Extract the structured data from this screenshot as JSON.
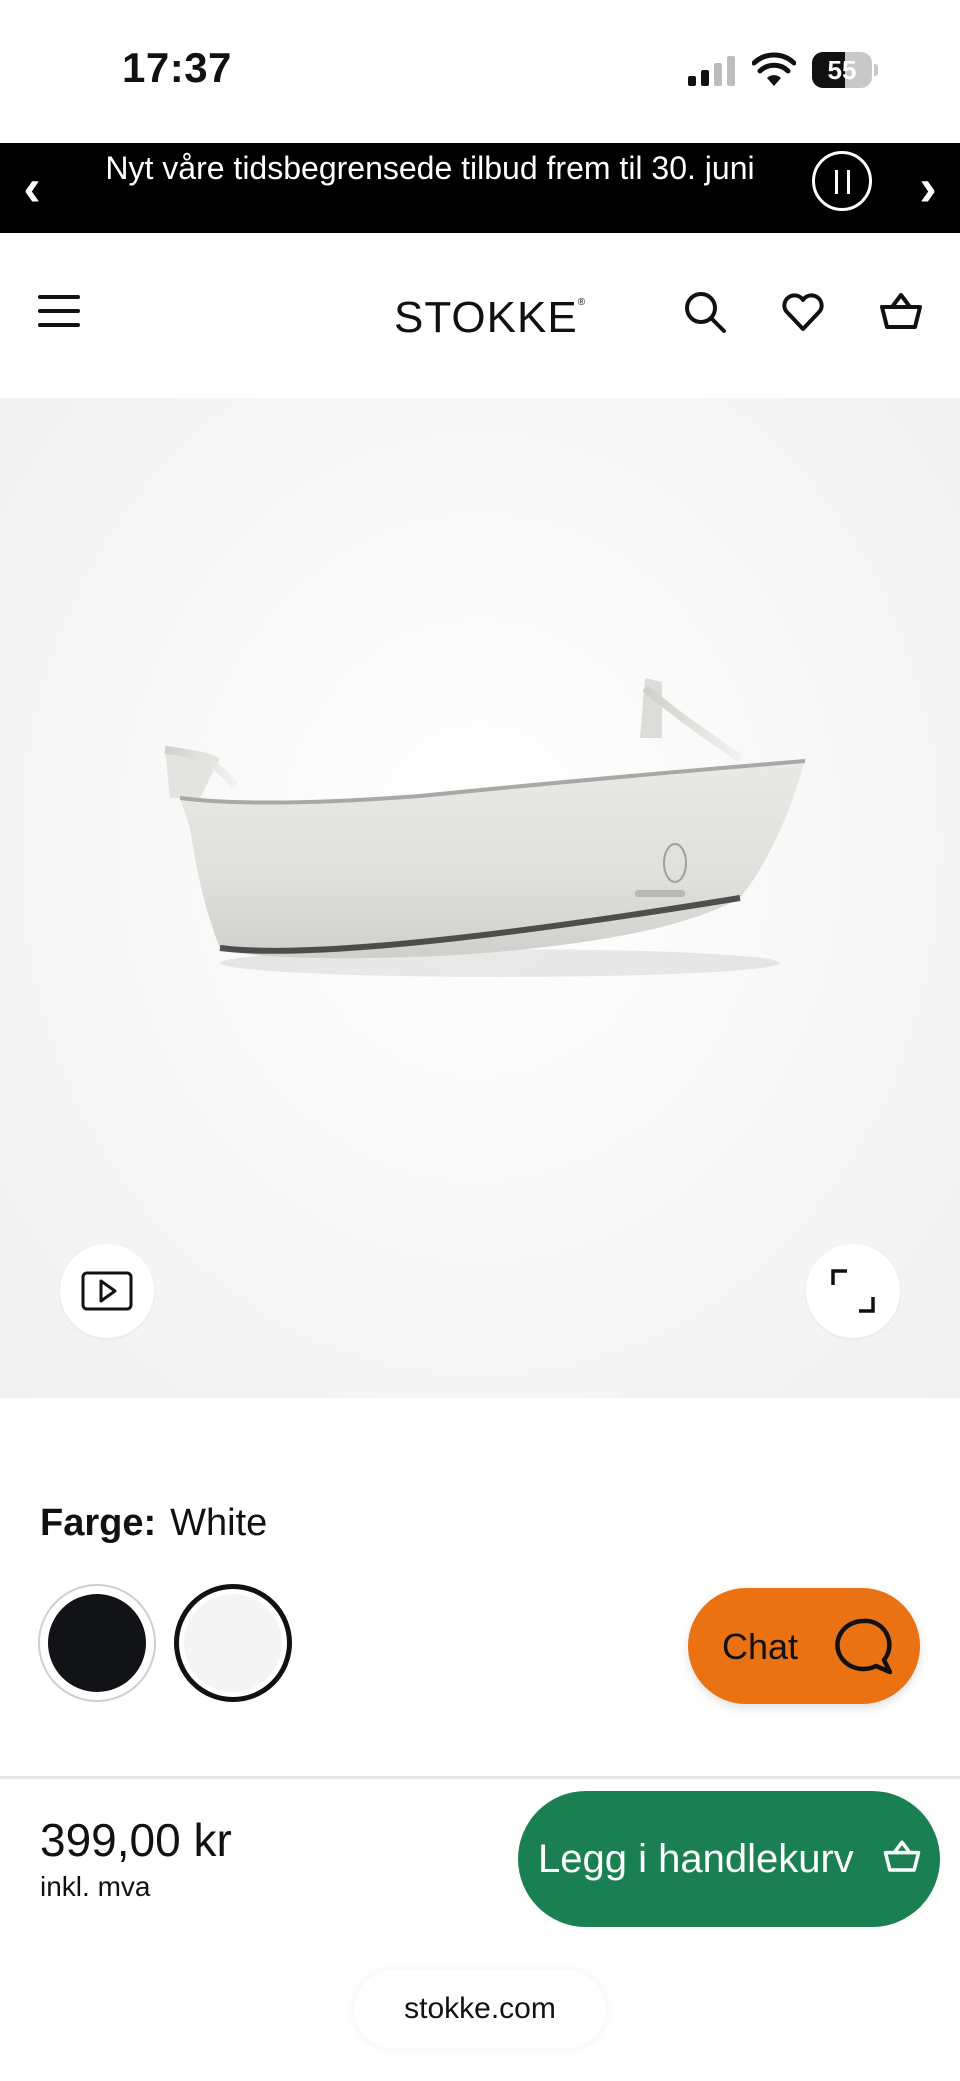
{
  "status_bar": {
    "time": "17:37",
    "battery": {
      "percent_label": "55",
      "level_percent": 55
    },
    "icons": [
      "cellular-signal-icon",
      "wifi-icon",
      "battery-icon"
    ]
  },
  "promo": {
    "text": "Nyt våre tidsbegrensede tilbud frem til 30. juni",
    "prev_glyph": "‹",
    "next_glyph": "›",
    "icons": [
      "chevron-left-icon",
      "pause-icon",
      "chevron-right-icon"
    ]
  },
  "header": {
    "logo": "STOKKE",
    "logo_mark": "®",
    "icons": [
      "menu-icon",
      "search-icon",
      "heart-icon",
      "basket-icon"
    ]
  },
  "product_media": {
    "icons": [
      "play-video-icon",
      "expand-icon"
    ]
  },
  "color": {
    "label": "Farge:",
    "selected": "White",
    "swatches": [
      {
        "name": "Black",
        "hex": "#121316",
        "selected": false
      },
      {
        "name": "White",
        "hex": "#f4f4f4",
        "selected": true
      }
    ]
  },
  "chat": {
    "label": "Chat",
    "accent": "#ea7213",
    "icon": "chat-bubble-icon"
  },
  "purchase": {
    "price": "399,00 kr",
    "vat_note": "inkl. mva",
    "add_to_cart_label": "Legg i handlekurv",
    "button_color": "#1a8052",
    "icon": "basket-icon"
  },
  "browser": {
    "url": "stokke.com"
  }
}
